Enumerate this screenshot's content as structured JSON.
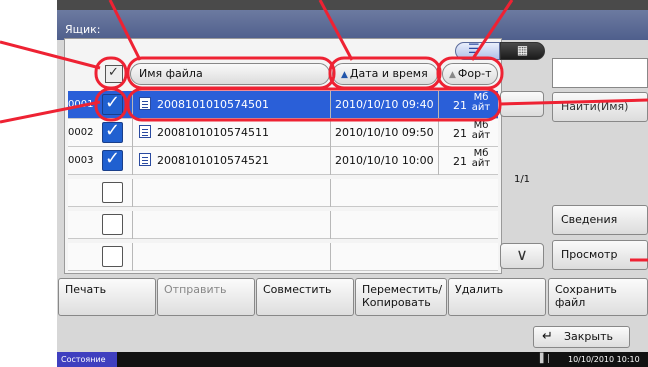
{
  "window": {
    "title": "Ящик:"
  },
  "view_toggle": {
    "list_icon": "list-icon",
    "grid_icon": "grid-icon"
  },
  "header": {
    "file_name": "Имя файла",
    "date_time": "Дата и время",
    "format": "Фор-т"
  },
  "rows": [
    {
      "num": "0001",
      "checked": true,
      "name": "2008101010574501",
      "date": "2010/10/10 09:40",
      "size": "21",
      "unit": "Мб айт",
      "selected": true
    },
    {
      "num": "0002",
      "checked": true,
      "name": "2008101010574511",
      "date": "2010/10/10 09:50",
      "size": "21",
      "unit": "Мб айт",
      "selected": false
    },
    {
      "num": "0003",
      "checked": true,
      "name": "2008101010574521",
      "date": "2010/10/10 10:00",
      "size": "21",
      "unit": "Мб айт",
      "selected": false
    }
  ],
  "page_indicator": "1/1",
  "side": {
    "find": "Найти(Имя)",
    "details": "Сведения",
    "preview": "Просмотр"
  },
  "bottom_buttons": {
    "print": "Печать",
    "send": "Отправить",
    "combine": "Совместить",
    "move_copy": "Переместить/ Копировать",
    "delete": "Удалить",
    "save_file": "Сохранить файл"
  },
  "close": "Закрыть",
  "status": {
    "label": "Состояние",
    "datetime": "10/10/2010 10:10"
  },
  "colors": {
    "selection": "#2a5fd8",
    "annotation": "#ee2233",
    "title_bar": "#4f5f8c"
  }
}
